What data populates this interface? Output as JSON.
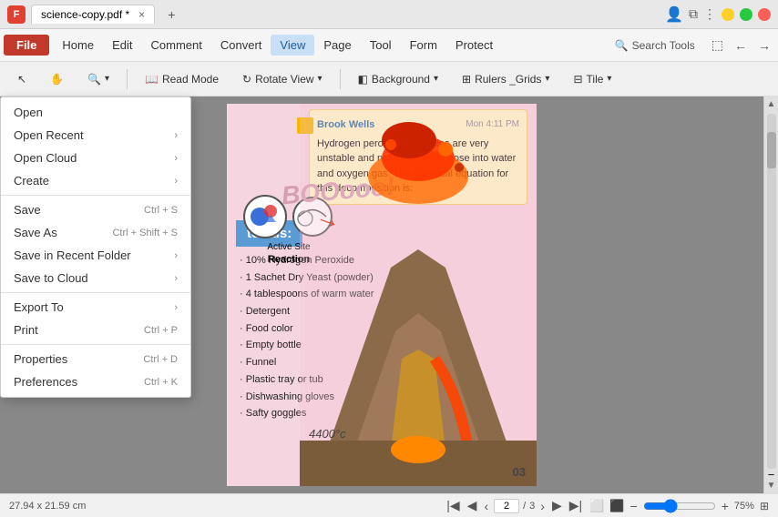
{
  "app": {
    "icon": "F",
    "tab_name": "science-copy.pdf *",
    "tab_close": "×",
    "tab_add": "+"
  },
  "window_controls": {
    "close": "×",
    "min": "−",
    "max": "□"
  },
  "menu_bar": {
    "file": "File",
    "home": "Home",
    "edit": "Edit",
    "comment": "Comment",
    "convert": "Convert",
    "view": "View",
    "page": "Page",
    "tool": "Tool",
    "form": "Form",
    "protect": "Protect",
    "search_tools": "Search Tools"
  },
  "toolbar": {
    "read_mode": "Read Mode",
    "rotate_view": "Rotate View",
    "background": "Background",
    "rulers_grids": "Rulers _Grids",
    "tile": "Tile"
  },
  "dropdown_menu": {
    "items": [
      {
        "label": "Open",
        "shortcut": "",
        "has_arrow": false
      },
      {
        "label": "Open Recent",
        "shortcut": "",
        "has_arrow": true
      },
      {
        "label": "Open Cloud",
        "shortcut": "",
        "has_arrow": true
      },
      {
        "label": "Create",
        "shortcut": "",
        "has_arrow": true
      },
      {
        "separator": true
      },
      {
        "label": "Save",
        "shortcut": "Ctrl + S",
        "has_arrow": false
      },
      {
        "label": "Save As",
        "shortcut": "Ctrl + Shift + S",
        "has_arrow": false
      },
      {
        "label": "Save in Recent Folder",
        "shortcut": "",
        "has_arrow": true
      },
      {
        "label": "Save to Cloud",
        "shortcut": "",
        "has_arrow": true
      },
      {
        "separator": true
      },
      {
        "label": "Export To",
        "shortcut": "",
        "has_arrow": true
      },
      {
        "label": "Print",
        "shortcut": "Ctrl + P",
        "has_arrow": false
      },
      {
        "separator": true
      },
      {
        "label": "Properties",
        "shortcut": "Ctrl + D",
        "has_arrow": false
      },
      {
        "label": "Preferences",
        "shortcut": "Ctrl + K",
        "has_arrow": false
      }
    ]
  },
  "document": {
    "materials_header": "terials:",
    "materials_list": [
      "10% Hydrogen Peroxide",
      "1 Sachet Dry Yeast (powder)",
      "4 tablespoons of warm water",
      "Detergent",
      "Food color",
      "Empty bottle",
      "Funnel",
      "Plastic tray or tub",
      "Dishwashing gloves",
      "Safty goggles"
    ],
    "reaction_label": "Reaction",
    "boo_text": "BOOooo!",
    "temp_label": "4400°c",
    "page_number": "03",
    "annotation": {
      "author": "Brook Wells",
      "time": "Mon 4:11 PM",
      "text": "Hydrogen peroxide molecules are very unstable and naturally decompose into water and oxygen gas. The chemical equation for this decomposition is:"
    }
  },
  "status_bar": {
    "dimensions": "27.94 x 21.59 cm",
    "page_current": "2",
    "page_total": "3",
    "zoom_percent": "75%"
  }
}
